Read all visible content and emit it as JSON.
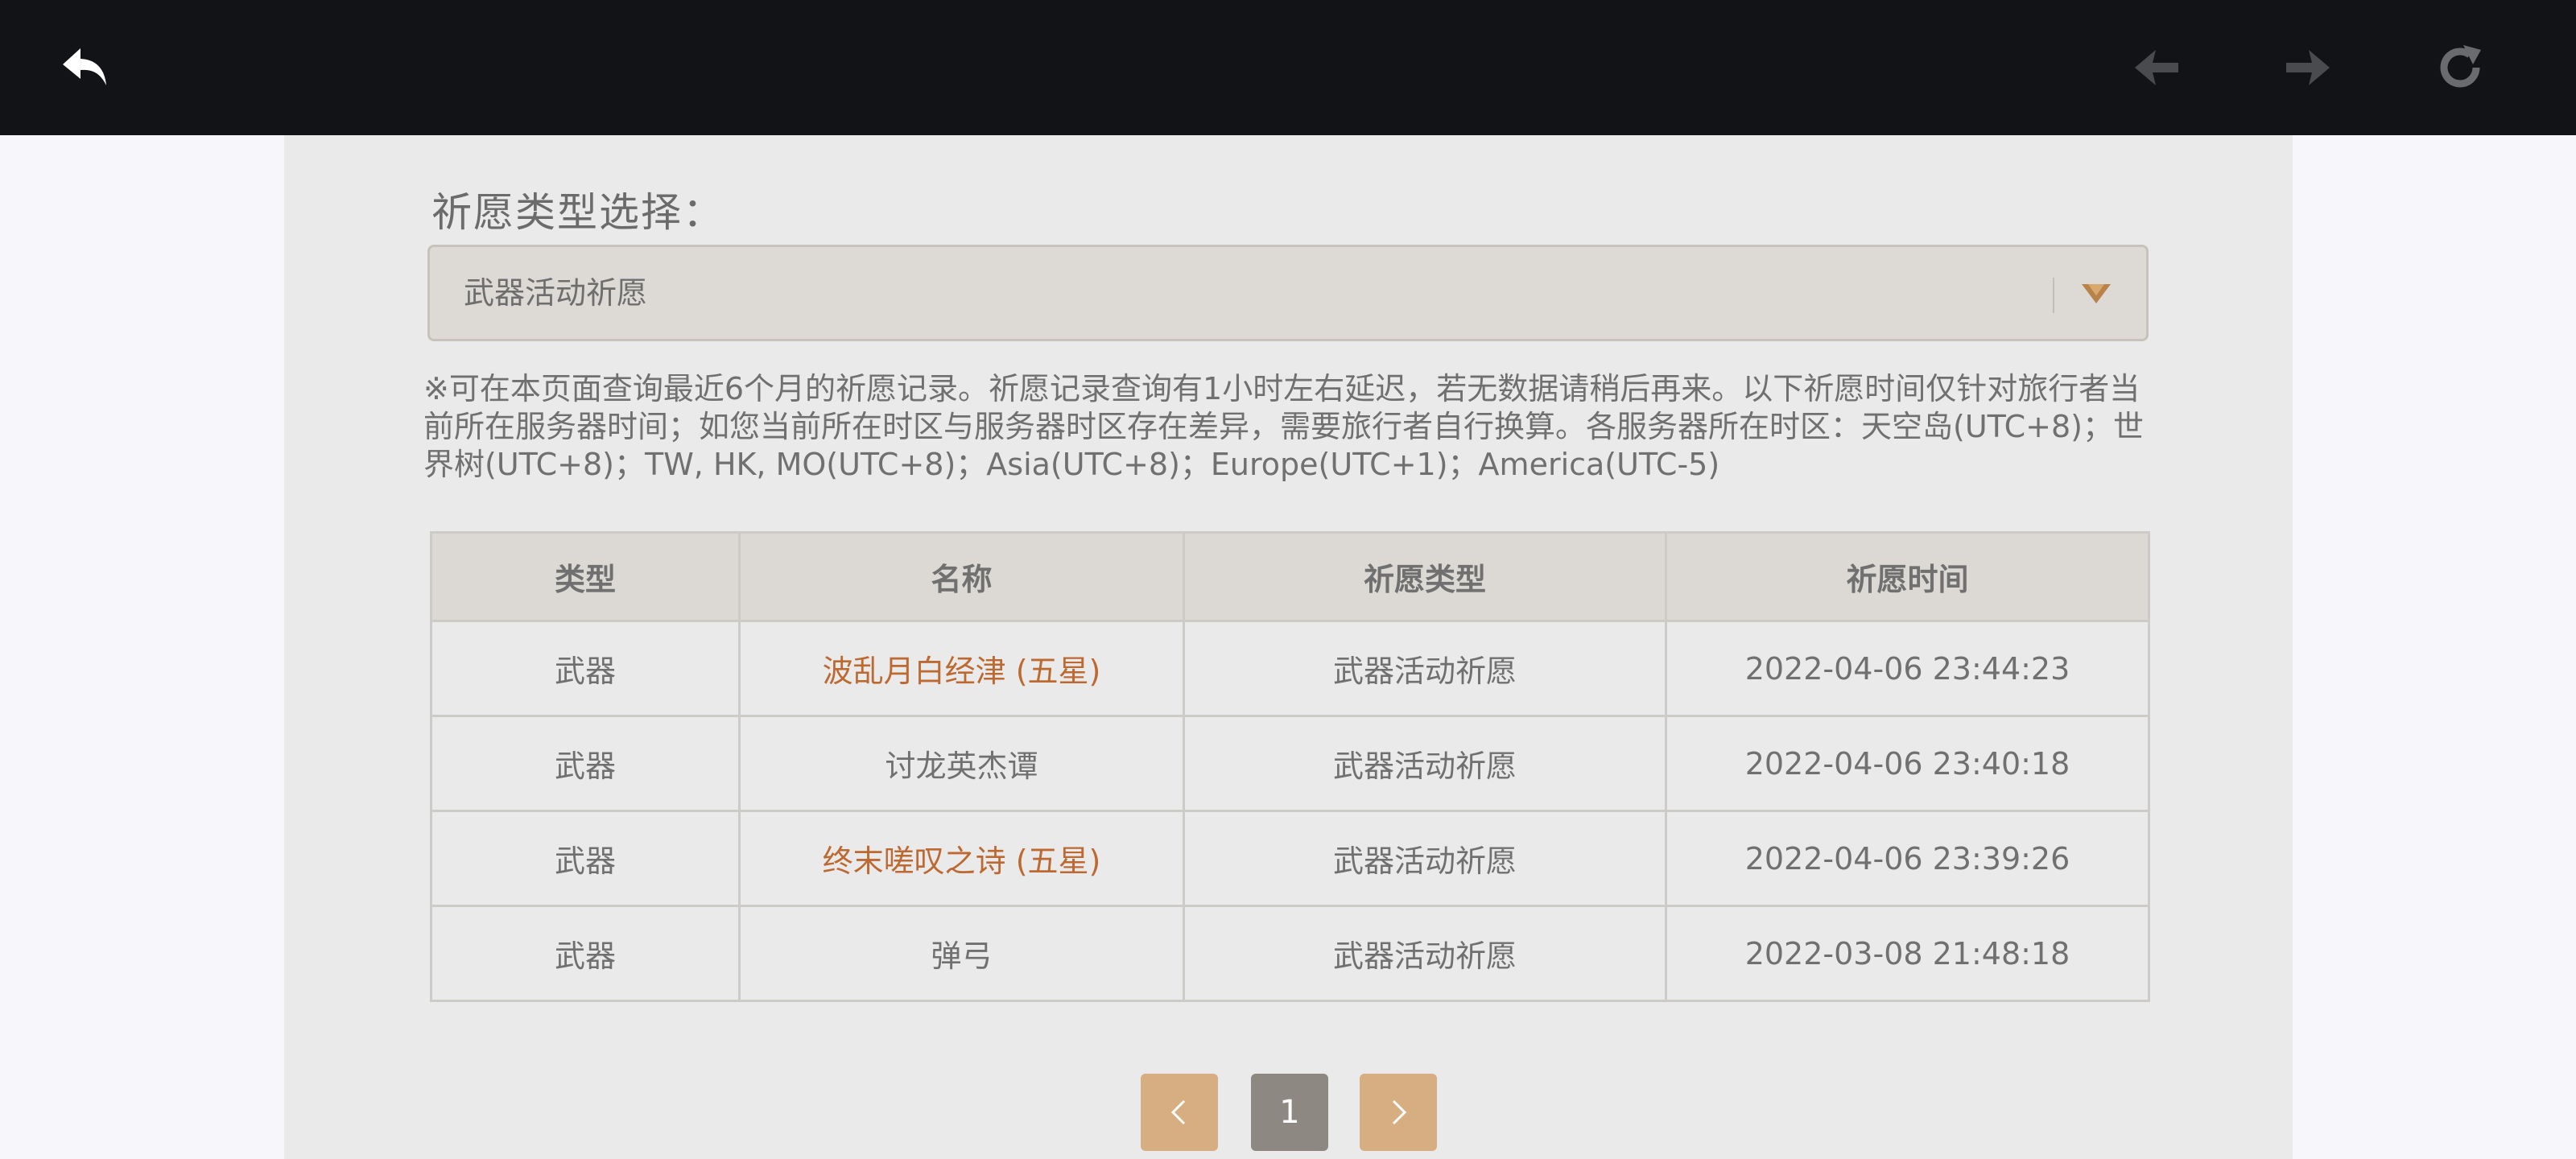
{
  "toolbar": {
    "back_icon": "undo-arrow-icon",
    "prev_icon": "diamond-left-icon",
    "next_icon": "diamond-right-icon",
    "refresh_icon": "refresh-icon"
  },
  "filter": {
    "label": "祈愿类型选择：",
    "selected": "武器活动祈愿"
  },
  "notice": "※可在本页面查询最近6个月的祈愿记录。祈愿记录查询有1小时左右延迟，若无数据请稍后再来。以下祈愿时间仅针对旅行者当前所在服务器时间；如您当前所在时区与服务器时区存在差异，需要旅行者自行换算。各服务器所在时区：天空岛(UTC+8)；世界树(UTC+8)；TW, HK, MO(UTC+8)；Asia(UTC+8)；Europe(UTC+1)；America(UTC-5)",
  "table": {
    "headers": [
      "类型",
      "名称",
      "祈愿类型",
      "祈愿时间"
    ],
    "rows": [
      {
        "type": "武器",
        "name": "波乱月白经津 (五星)",
        "wish_type": "武器活动祈愿",
        "time": "2022-04-06 23:44:23",
        "five_star": true
      },
      {
        "type": "武器",
        "name": "讨龙英杰谭",
        "wish_type": "武器活动祈愿",
        "time": "2022-04-06 23:40:18",
        "five_star": false
      },
      {
        "type": "武器",
        "name": "终末嗟叹之诗 (五星)",
        "wish_type": "武器活动祈愿",
        "time": "2022-04-06 23:39:26",
        "five_star": true
      },
      {
        "type": "武器",
        "name": "弹弓",
        "wish_type": "武器活动祈愿",
        "time": "2022-03-08 21:48:18",
        "five_star": false
      }
    ]
  },
  "pagination": {
    "current_page": "1"
  },
  "colors": {
    "five_star_text": "#bd6932",
    "pager_button": "#d6ae82",
    "pager_current": "#8e8883",
    "topbar": "#121316"
  }
}
